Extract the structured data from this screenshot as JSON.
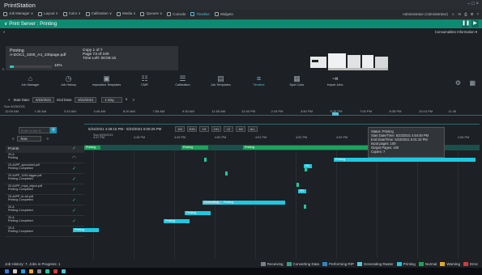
{
  "window": {
    "title": "PrintStation",
    "controls": "– □ ×"
  },
  "menu": {
    "items": [
      {
        "label": "Job Manager ∨",
        "icon": "briefcase-icon"
      },
      {
        "label": "Layout ∨",
        "icon": "layout-icon"
      },
      {
        "label": "Color ∨",
        "icon": "color-icon"
      },
      {
        "label": "Calibration ∨",
        "icon": "calibration-icon"
      },
      {
        "label": "Media ∨",
        "icon": "media-icon"
      },
      {
        "label": "Queues ∨",
        "icon": "queues-icon"
      },
      {
        "label": "Console",
        "icon": "console-icon"
      },
      {
        "label": "Timeline",
        "icon": "timeline-icon",
        "active": true
      },
      {
        "label": "Widgets",
        "icon": "widgets-icon"
      }
    ],
    "user": "Administrator (Administrator)"
  },
  "server": {
    "label": "∨  Print Server : Printing"
  },
  "consumables": "Consumables Information ▾",
  "job": {
    "status": "Printing",
    "name": "A-DOC1_1000_A4_100page.pdf",
    "progress_pct": 10,
    "progress_text": "10%",
    "copy": "Copy 1 of 7",
    "page": "Page 73 of 100",
    "time_left": "Time Left: 00:06:15"
  },
  "toolbar": [
    {
      "label": "Job Manager",
      "glyph": "⌂"
    },
    {
      "label": "Job History",
      "glyph": "◷"
    },
    {
      "label": "Imposition Templates",
      "glyph": "▣"
    },
    {
      "label": "CMR",
      "glyph": "☷"
    },
    {
      "label": "Calibration",
      "glyph": "☰"
    },
    {
      "label": "Job Templates",
      "glyph": "▤"
    },
    {
      "label": "Timeline",
      "glyph": "≡",
      "active": true
    },
    {
      "label": "Spot Color",
      "glyph": "▦"
    },
    {
      "label": "Import Jobs",
      "glyph": "⇥"
    }
  ],
  "timefilter": {
    "start_label": "Start Date:",
    "start": "5/23/2021",
    "end_label": "End Date:",
    "end": "5/23/2021",
    "range": "1 Day"
  },
  "ruler": {
    "date": "Sun 5/23/2021",
    "ticks": [
      "12:00 AM",
      "1:30 AM",
      "3:10 AM",
      "4:40 AM",
      "6:20 AM",
      "7:55 AM",
      "9:30 AM",
      "11:05 AM",
      "12:40 PM",
      "2:15 PM",
      "3:50 PM",
      "5:25 PM",
      "7:00 PM",
      "8:35 PM",
      "10:10 PM",
      "11:45"
    ]
  },
  "search": {
    "placeholder": "Enter a Job N",
    "now": "Now"
  },
  "gantt": {
    "range": "5/23/2021 4:48:15 PM - 5/23/2021 5:00:25 PM",
    "zoom": [
      "1M",
      "30M",
      "1H",
      "1H1",
      "12",
      "1W",
      "ALL"
    ],
    "date": "Sun 5/23/2021",
    "ticks": [
      "4:47 PM",
      "4:48 PM",
      "4:49 PM",
      "4:50 PM",
      "4:51 PM",
      "4:52 PM",
      "4:53 PM",
      "4:54 PM",
      "4:55 PM",
      "4:56 PM"
    ]
  },
  "tooltip": {
    "lines": [
      "Status: Printing",
      "Start Date/Time: 5/23/2021 4:54:00 PM",
      "End Date/Time: 5/23/2021 5:01:10 PM",
      "Input pages: 100",
      "Output Pages: 100",
      "Copies: 7"
    ]
  },
  "points_header": "Points",
  "rows": [
    {
      "name": "20-A",
      "status": "Printing",
      "busy": true
    },
    {
      "name": "20-A4PP_specsheet.pdf",
      "status": "Printing Completed"
    },
    {
      "name": "20-A4PP_1030-bigger.pdf",
      "status": "Printing Completed"
    },
    {
      "name": "20-A4PP_rmps_object.pdf",
      "status": "Printing Completed"
    },
    {
      "name": "20-A4PP_te.xel.pdf",
      "status": "Printing Completed"
    },
    {
      "name": "20-A",
      "status": "Printing Completed"
    },
    {
      "name": "20-A",
      "status": "Printing Completed"
    },
    {
      "name": "20-A",
      "status": "Printing Completed"
    }
  ],
  "bars": [
    {
      "row": -1,
      "label": "Printing",
      "kind": "print"
    },
    {
      "row": -1,
      "label": "Printing",
      "kind": "print"
    },
    {
      "row": -1,
      "label": "Printing",
      "kind": "print"
    },
    {
      "row": 0,
      "label": "Printing",
      "kind": "print"
    },
    {
      "row": 1,
      "label": "PR",
      "kind": "print"
    },
    {
      "row": 3,
      "label": "PR",
      "kind": "print"
    },
    {
      "row": 4,
      "label": "Generating",
      "kind": "convert"
    },
    {
      "row": 4,
      "label": "Printing",
      "kind": "print"
    },
    {
      "row": 5,
      "label": "Printing",
      "kind": "print"
    },
    {
      "row": 6,
      "label": "Printing",
      "kind": "print"
    },
    {
      "row": 7,
      "label": "Printing",
      "kind": "print"
    }
  ],
  "status": {
    "text": "Job History: 7, Jobs in Progress: 1",
    "legend": [
      {
        "label": "Receiving",
        "color": "#7a7f86"
      },
      {
        "label": "Converting Data",
        "color": "#3a9a8a"
      },
      {
        "label": "Performing RIP",
        "color": "#2f86c0"
      },
      {
        "label": "Generating Raster",
        "color": "#59c7d8"
      },
      {
        "label": "Printing",
        "color": "#1ec8e0"
      },
      {
        "label": "Normal",
        "color": "#1ba35a"
      },
      {
        "label": "Warning",
        "color": "#e0a92a"
      },
      {
        "label": "Error",
        "color": "#d23a3a"
      }
    ]
  }
}
